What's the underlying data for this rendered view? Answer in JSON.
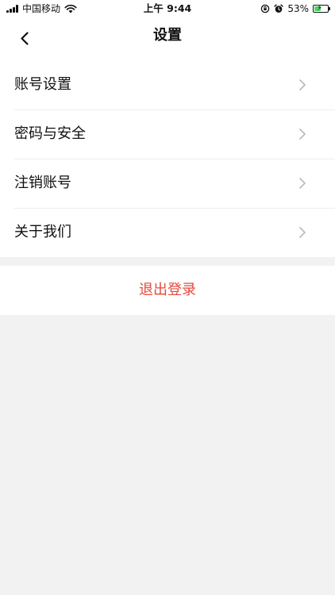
{
  "status_bar": {
    "carrier": "中国移动",
    "time": "上午 9:44",
    "battery_percent_text": "53%",
    "battery_level": 0.53,
    "icons": [
      "signal-icon",
      "wifi-icon",
      "orientation-lock-icon",
      "alarm-icon",
      "battery-icon"
    ]
  },
  "header": {
    "title": "设置",
    "back_icon": "chevron-left-icon"
  },
  "menu": {
    "items": [
      {
        "label": "账号设置"
      },
      {
        "label": "密码与安全"
      },
      {
        "label": "注销账号"
      },
      {
        "label": "关于我们"
      }
    ],
    "chevron_icon": "chevron-right-icon"
  },
  "logout": {
    "label": "退出登录"
  },
  "colors": {
    "background": "#f2f2f2",
    "card": "#ffffff",
    "text": "#111111",
    "chevron": "#b8b8b8",
    "danger": "#e8483a",
    "battery_fill": "#4cd964"
  }
}
